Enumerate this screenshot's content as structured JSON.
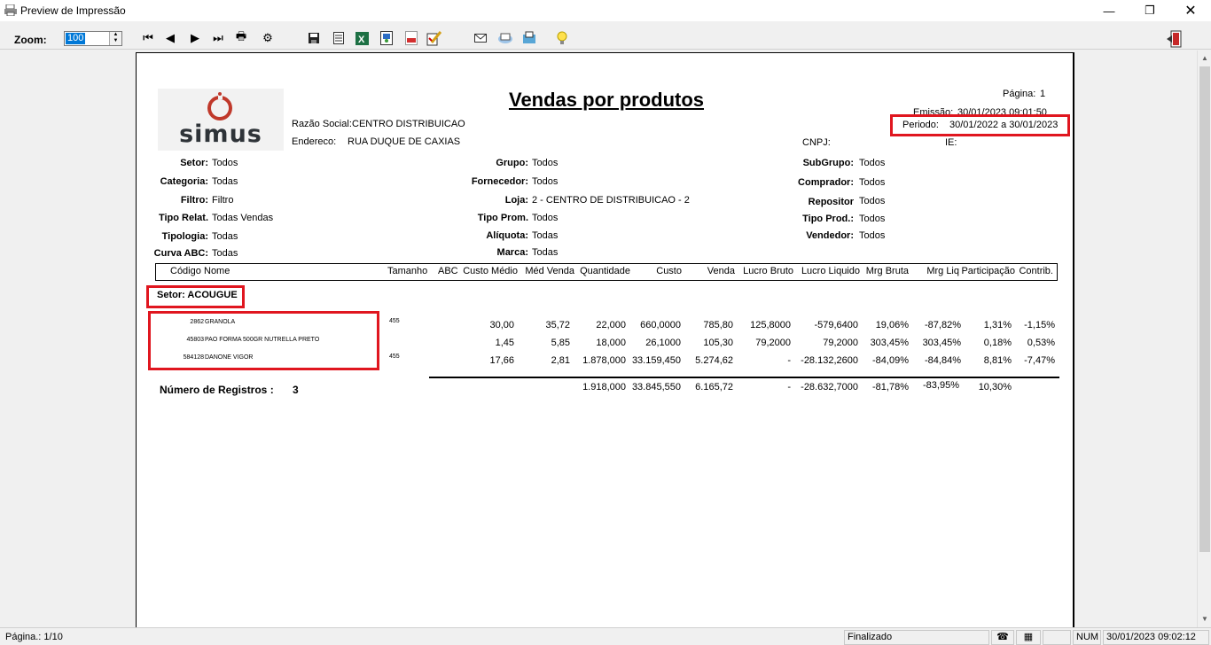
{
  "window": {
    "title": "Preview de Impressão"
  },
  "toolbar": {
    "zoom_label": "Zoom:",
    "zoom_value": "100",
    "buttons": [
      "first-page-icon",
      "prev-page-icon",
      "next-page-icon",
      "last-page-icon",
      "print-icon",
      "print-setup-icon",
      "save-icon",
      "export-text-icon",
      "export-excel-icon",
      "export-word-icon",
      "export-pdf-icon",
      "edit-icon",
      "email-icon",
      "email-send-icon",
      "fax-icon",
      "tip-icon",
      "exit-icon"
    ]
  },
  "report": {
    "logo_text": "simus",
    "title": "Vendas por produtos",
    "page_label": "Página:",
    "page_value": "1",
    "emissao_label": "Emissão:",
    "emissao_value": "30/01/2023 09:01:50",
    "periodo_label": "Periodo:",
    "periodo_value": "30/01/2022 a 30/01/2023",
    "razao_label": "Razão Social:",
    "razao_value": "CENTRO DISTRIBUICAO",
    "endereco_label": "Endereco:",
    "endereco_value": "RUA DUQUE DE CAXIAS",
    "cnpj_label": "CNPJ:",
    "ie_label": "IE:",
    "filters_left": [
      {
        "label": "Setor:",
        "value": "Todos"
      },
      {
        "label": "Categoria:",
        "value": "Todas"
      },
      {
        "label": "Filtro:",
        "value": "Filtro"
      },
      {
        "label": "Tipo Relat.",
        "value": "Todas Vendas"
      },
      {
        "label": "Tipologia:",
        "value": "Todas"
      },
      {
        "label": "Curva ABC:",
        "value": "Todas"
      }
    ],
    "filters_mid": [
      {
        "label": "Grupo:",
        "value": "Todos"
      },
      {
        "label": "Fornecedor:",
        "value": "Todos"
      },
      {
        "label": "Loja:",
        "value": "2 - CENTRO DE DISTRIBUICAO - 2"
      },
      {
        "label": "Tipo Prom.",
        "value": "Todos"
      },
      {
        "label": "Alíquota:",
        "value": "Todas"
      },
      {
        "label": "Marca:",
        "value": "Todas"
      }
    ],
    "filters_right": [
      {
        "label": "SubGrupo:",
        "value": "Todos"
      },
      {
        "label": "Comprador:",
        "value": "Todos"
      },
      {
        "label": "Repositor",
        "value": "Todos"
      },
      {
        "label": "Tipo Prod.:",
        "value": "Todos"
      },
      {
        "label": "Vendedor:",
        "value": "Todos"
      }
    ],
    "columns": {
      "codigo": "Código",
      "nome": "Nome",
      "tamanho": "Tamanho",
      "abc": "ABC",
      "custo_medio": "Custo Médio",
      "med_venda": "Méd Venda",
      "quantidade": "Quantidade",
      "custo": "Custo",
      "venda": "Venda",
      "lucro_bruto": "Lucro Bruto",
      "lucro_liquido": "Lucro Liquido",
      "mrg_bruta": "Mrg Bruta",
      "mrg_liq": "Mrg Liq",
      "participacao": "Participação",
      "contrib": "Contrib."
    },
    "sector": "Setor: ACOUGUE",
    "rows": [
      {
        "codigo": "2862",
        "nome": "GRANOLA",
        "tamanho": "455",
        "custo_medio": "30,00",
        "med_venda": "35,72",
        "quantidade": "22,000",
        "custo": "660,0000",
        "venda": "785,80",
        "lucro_bruto": "125,8000",
        "lucro_liquido": "-579,6400",
        "mrg_bruta": "19,06%",
        "mrg_liq": "-87,82%",
        "participacao": "1,31%",
        "contrib": "-1,15%"
      },
      {
        "codigo": "45803",
        "nome": "PAO FORMA 500GR NUTRELLA PRETO",
        "tamanho": "",
        "custo_medio": "1,45",
        "med_venda": "5,85",
        "quantidade": "18,000",
        "custo": "26,1000",
        "venda": "105,30",
        "lucro_bruto": "79,2000",
        "lucro_liquido": "79,2000",
        "mrg_bruta": "303,45%",
        "mrg_liq": "303,45%",
        "participacao": "0,18%",
        "contrib": "0,53%"
      },
      {
        "codigo": "584128",
        "nome": "DANONE VIGOR",
        "tamanho": "455",
        "custo_medio": "17,66",
        "med_venda": "2,81",
        "quantidade": "1.878,000",
        "custo": "33.159,450",
        "venda": "5.274,62",
        "lucro_bruto": "-",
        "lucro_liquido": "-28.132,2600",
        "mrg_bruta": "-84,09%",
        "mrg_liq": "-84,84%",
        "participacao": "8,81%",
        "contrib": "-7,47%"
      }
    ],
    "records_label": "Número de Registros :",
    "records_value": "3",
    "totals": {
      "quantidade": "1.918,000",
      "custo": "33.845,550",
      "venda": "6.165,72",
      "lucro_bruto": "-",
      "lucro_liquido": "-28.632,7000",
      "mrg_bruta": "-81,78%",
      "mrg_liq": "-83,95%",
      "participacao": "10,30%"
    }
  },
  "status": {
    "page": "Página.: 1/10",
    "state": "Finalizado",
    "num": "NUM",
    "datetime": "30/01/2023 09:02:12"
  }
}
